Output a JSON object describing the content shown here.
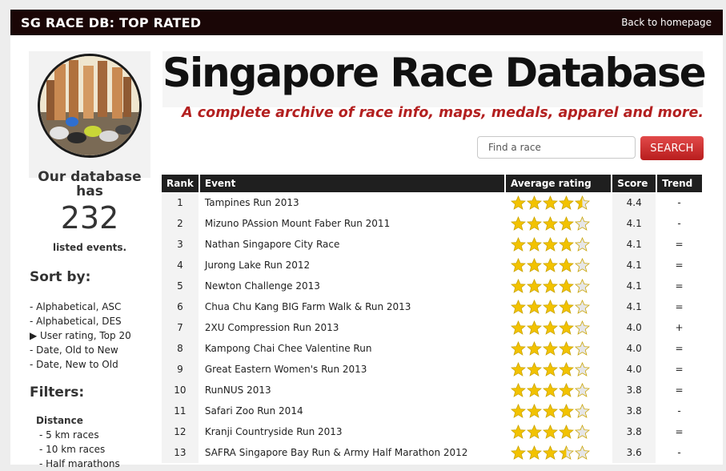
{
  "topbar": {
    "title": "SG RACE DB: TOP RATED",
    "home_link": "Back to homepage"
  },
  "header": {
    "logo_text": "Singapore Race Database",
    "tagline": "A complete archive of race info, maps, medals, apparel and more."
  },
  "search": {
    "placeholder": "Find a race",
    "button_label": "SEARCH"
  },
  "sidebar": {
    "db_has": "Our database has",
    "count": "232",
    "listed": "listed events.",
    "sort_heading": "Sort by:",
    "sort_options": [
      "- Alphabetical, ASC",
      "- Alphabetical, DES",
      "▶ User rating, Top 20",
      "- Date, Old to New",
      "- Date, New to Old"
    ],
    "filters_heading": "Filters:",
    "filter_group": "Distance",
    "filter_options": [
      "- 5 km races",
      "- 10 km races",
      "- Half marathons"
    ]
  },
  "table": {
    "headers": [
      "Rank",
      "Event",
      "Average rating",
      "Score",
      "Trend"
    ],
    "rows": [
      {
        "rank": "1",
        "event": "Tampines Run 2013",
        "stars": 4.5,
        "score": "4.4",
        "trend": "-"
      },
      {
        "rank": "2",
        "event": "Mizuno PAssion Mount Faber Run 2011",
        "stars": 4,
        "score": "4.1",
        "trend": "-"
      },
      {
        "rank": "3",
        "event": "Nathan Singapore City Race",
        "stars": 4,
        "score": "4.1",
        "trend": "="
      },
      {
        "rank": "4",
        "event": "Jurong Lake Run 2012",
        "stars": 4,
        "score": "4.1",
        "trend": "="
      },
      {
        "rank": "5",
        "event": "Newton Challenge 2013",
        "stars": 4,
        "score": "4.1",
        "trend": "="
      },
      {
        "rank": "6",
        "event": "Chua Chu Kang BIG Farm Walk & Run 2013",
        "stars": 4,
        "score": "4.1",
        "trend": "="
      },
      {
        "rank": "7",
        "event": "2XU Compression Run 2013",
        "stars": 4,
        "score": "4.0",
        "trend": "+"
      },
      {
        "rank": "8",
        "event": "Kampong Chai Chee Valentine Run",
        "stars": 4,
        "score": "4.0",
        "trend": "="
      },
      {
        "rank": "9",
        "event": "Great Eastern Women's Run 2013",
        "stars": 4,
        "score": "4.0",
        "trend": "="
      },
      {
        "rank": "10",
        "event": "RunNUS 2013",
        "stars": 4,
        "score": "3.8",
        "trend": "="
      },
      {
        "rank": "11",
        "event": "Safari Zoo Run 2014",
        "stars": 4,
        "score": "3.8",
        "trend": "-"
      },
      {
        "rank": "12",
        "event": "Kranji Countryside Run 2013",
        "stars": 4,
        "score": "3.8",
        "trend": "="
      },
      {
        "rank": "13",
        "event": "SAFRA Singapore Bay Run & Army Half Marathon 2012",
        "stars": 3.5,
        "score": "3.6",
        "trend": "-"
      }
    ]
  },
  "colors": {
    "topbar": "#1a0606",
    "accent": "#b32020",
    "star": "#f2c200"
  }
}
